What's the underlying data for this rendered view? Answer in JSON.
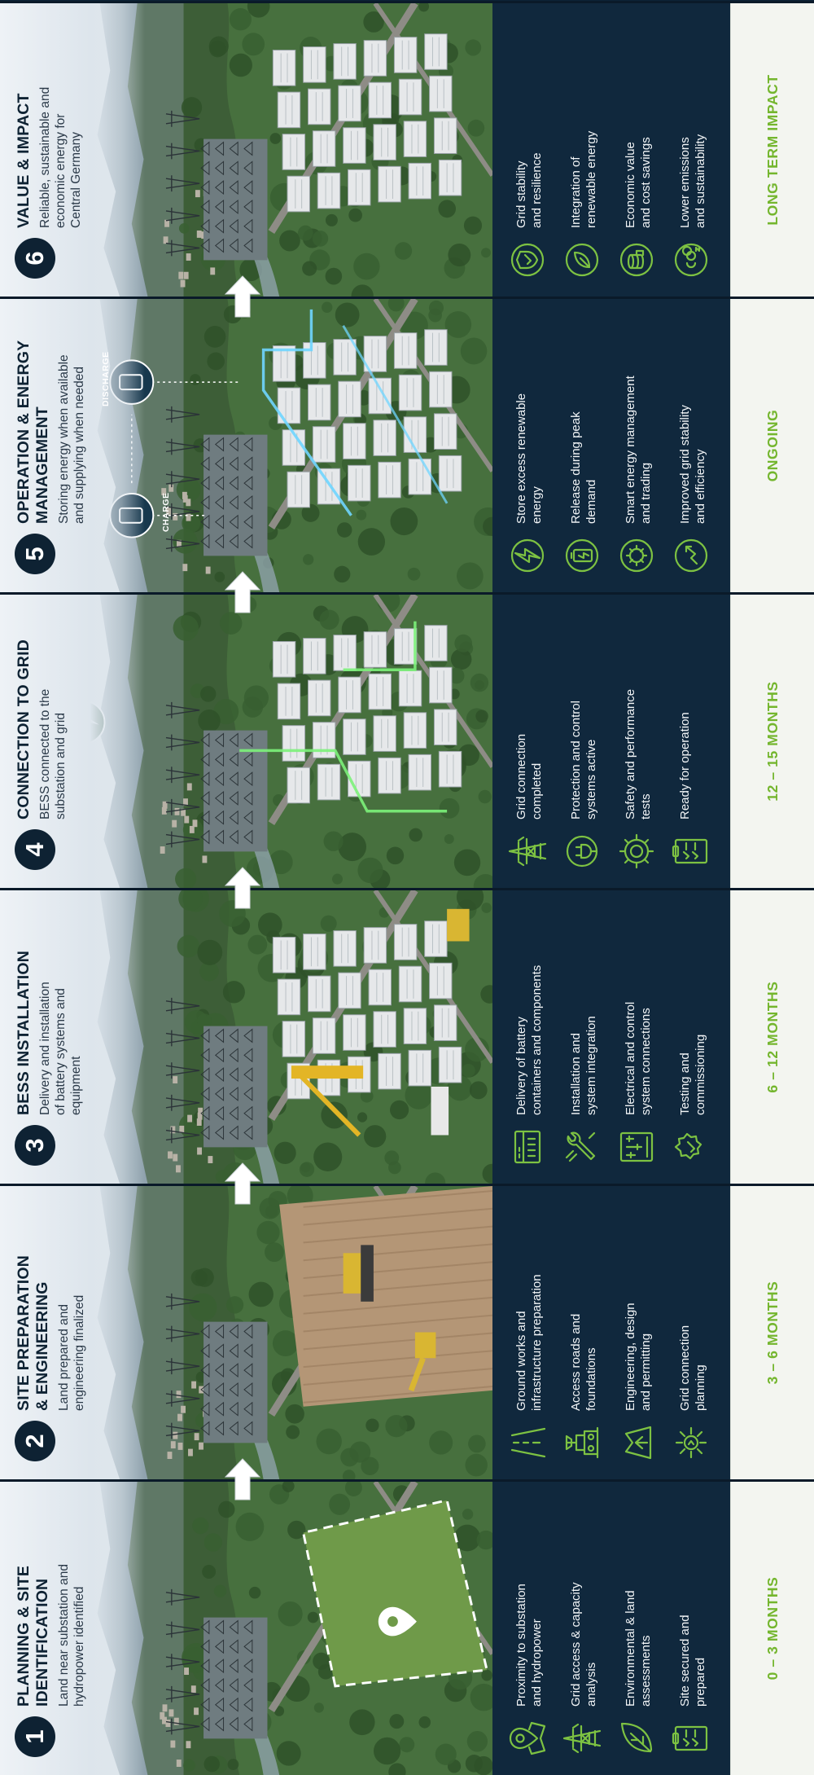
{
  "stages": [
    {
      "number": "1",
      "title_lines": [
        "PLANNING & SITE",
        "IDENTIFICATION"
      ],
      "subtitle_lines": [
        "Land near substation and",
        "hydropower identified"
      ],
      "items": [
        {
          "icon": "map-pin-icon",
          "lines": [
            "Proximity to substation",
            "and hydropower"
          ]
        },
        {
          "icon": "power-tower-icon",
          "lines": [
            "Grid access & capacity",
            "analysis"
          ]
        },
        {
          "icon": "leaf-icon",
          "lines": [
            "Environmental & land",
            "assessments"
          ]
        },
        {
          "icon": "checklist-icon",
          "lines": [
            "Site secured and",
            "prepared"
          ]
        }
      ],
      "timeline": "0 – 3 MONTHS"
    },
    {
      "number": "2",
      "title_lines": [
        "SITE PREPARATION",
        "& ENGINEERING"
      ],
      "subtitle_lines": [
        "Land prepared and",
        "engineering finalized"
      ],
      "items": [
        {
          "icon": "road-icon",
          "lines": [
            "Ground works and",
            "infrastructure preparation"
          ]
        },
        {
          "icon": "foundation-icon",
          "lines": [
            "Access roads and",
            "foundations"
          ]
        },
        {
          "icon": "blueprint-icon",
          "lines": [
            "Engineering, design",
            "and permitting"
          ]
        },
        {
          "icon": "grid-gear-icon",
          "lines": [
            "Grid connection",
            "planning"
          ]
        }
      ],
      "timeline": "3 – 6 MONTHS"
    },
    {
      "number": "3",
      "title_lines": [
        "BESS INSTALLATION"
      ],
      "subtitle_lines": [
        "Delivery and installation",
        "of battery systems and",
        "equipment"
      ],
      "items": [
        {
          "icon": "battery-container-icon",
          "lines": [
            "Delivery of battery",
            "containers and components"
          ]
        },
        {
          "icon": "wrench-icon",
          "lines": [
            "Installation and",
            "system integration"
          ]
        },
        {
          "icon": "control-panel-icon",
          "lines": [
            "Electrical and control",
            "system connections"
          ]
        },
        {
          "icon": "commissioning-gear-icon",
          "lines": [
            "Testing and",
            "commissioning"
          ]
        }
      ],
      "timeline": "6 – 12 MONTHS"
    },
    {
      "number": "4",
      "title_lines": [
        "CONNECTION TO GRID"
      ],
      "subtitle_lines": [
        "BESS connected to the",
        "substation and grid"
      ],
      "items": [
        {
          "icon": "power-tower-icon",
          "lines": [
            "Grid connection",
            "completed"
          ]
        },
        {
          "icon": "shield-plug-icon",
          "lines": [
            "Protection and control",
            "systems active"
          ]
        },
        {
          "icon": "gear-icon",
          "lines": [
            "Safety and performance",
            "tests"
          ]
        },
        {
          "icon": "checklist-icon",
          "lines": [
            "Ready for operation"
          ]
        }
      ],
      "timeline": "12 – 15 MONTHS"
    },
    {
      "number": "5",
      "title_lines": [
        "OPERATION & ENERGY",
        "MANAGEMENT"
      ],
      "subtitle_lines": [
        "Storing energy when available",
        "and supplying when needed"
      ],
      "items": [
        {
          "icon": "lightning-icon",
          "lines": [
            "Store excess renewable",
            "energy"
          ]
        },
        {
          "icon": "battery-icon",
          "lines": [
            "Release during peak",
            "demand"
          ]
        },
        {
          "icon": "smart-gear-icon",
          "lines": [
            "Smart energy management",
            "and trading"
          ]
        },
        {
          "icon": "efficiency-gear-icon",
          "lines": [
            "Improved grid stability",
            "and efficiency"
          ]
        }
      ],
      "timeline": "ONGOING",
      "charge_label": "CHARGE",
      "discharge_label": "DISCHARGE"
    },
    {
      "number": "6",
      "title_lines": [
        "VALUE & IMPACT"
      ],
      "subtitle_lines": [
        "Reliable, sustainable and",
        "economic energy for",
        "Central Germany"
      ],
      "items": [
        {
          "icon": "shield-icon",
          "lines": [
            "Grid stability",
            "and resilience"
          ]
        },
        {
          "icon": "renewable-leaf-icon",
          "lines": [
            "Integration of",
            "renewable energy"
          ]
        },
        {
          "icon": "coins-icon",
          "lines": [
            "Economic value",
            "and cost savings"
          ]
        },
        {
          "icon": "co2-icon",
          "lines": [
            "Lower emissions",
            "and sustainability"
          ]
        }
      ],
      "timeline": "LONG TERM IMPACT"
    }
  ],
  "colors": {
    "navy": "#10283d",
    "accent_green": "#74b62e",
    "icon_green": "#7dc242",
    "glow_green": "#7cf27a",
    "glow_blue": "#6fd5ff"
  }
}
